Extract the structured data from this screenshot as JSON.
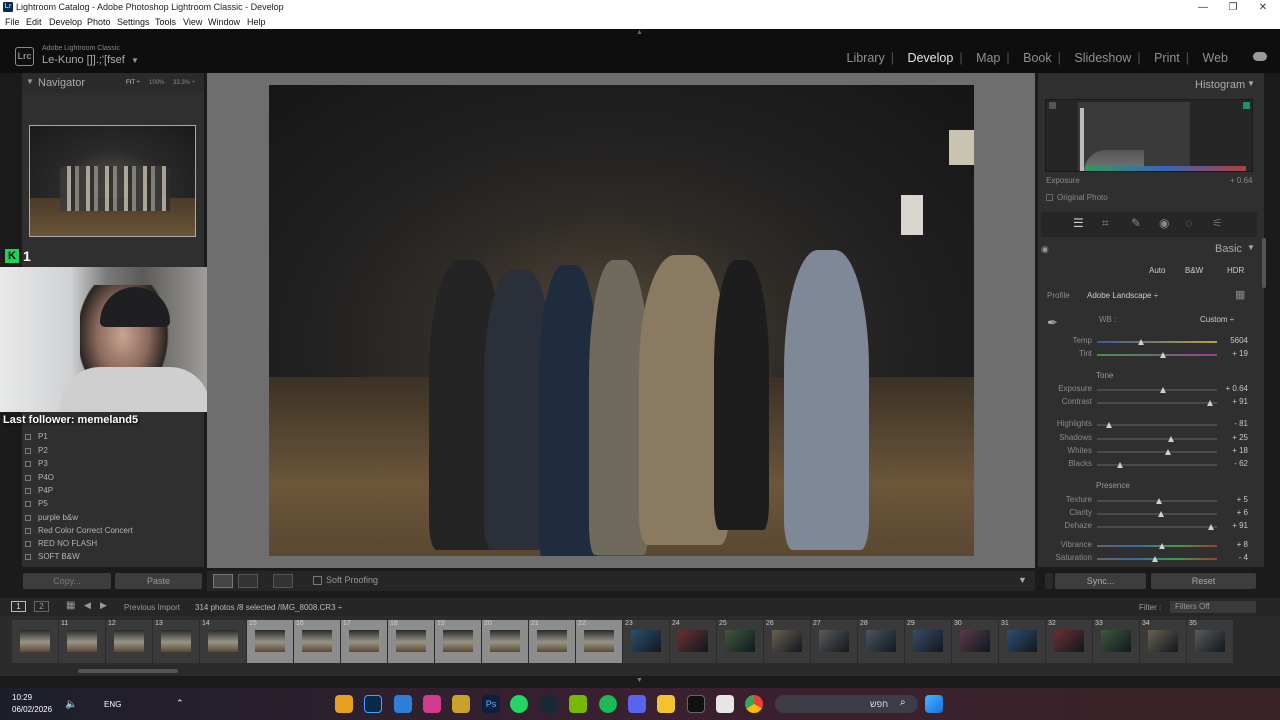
{
  "window": {
    "title": "Lightroom Catalog - Adobe Photoshop Lightroom Classic - Develop",
    "menu": [
      "File",
      "Edit",
      "Develop",
      "Photo",
      "Settings",
      "Tools",
      "View",
      "Window",
      "Help"
    ]
  },
  "header": {
    "brand": "Adobe Lightroom Classic",
    "catalog": "Le-Kuno []].;'[fsef",
    "logo": "Lrc",
    "modules": [
      "Library",
      "Develop",
      "Map",
      "Book",
      "Slideshow",
      "Print",
      "Web"
    ],
    "active_module": "Develop"
  },
  "left": {
    "navigator_title": "Navigator",
    "zoom_options": [
      "FIT ÷",
      "100%",
      "33.3% ÷"
    ],
    "presets": [
      "P1",
      "P2",
      "P3",
      "P4O",
      "P4P",
      "P5",
      "purple b&w",
      "Red Color Correct Concert",
      "RED NO FLASH",
      "SOFT B&W"
    ],
    "copy_label": "Copy...",
    "paste_label": "Paste"
  },
  "overlay": {
    "badge": "K",
    "count": "1",
    "last_follower": "Last follower: memeland5"
  },
  "toolbar": {
    "soft_proofing": "Soft Proofing"
  },
  "right": {
    "histogram_title": "Histogram",
    "exposure_label": "Exposure",
    "exposure_value": "+ 0.64",
    "original_photo": "Original Photo",
    "basic_title": "Basic",
    "treatment": [
      "Auto",
      "B&W",
      "HDR"
    ],
    "profile_label": "Profile",
    "profile_value": "Adobe Landscape ÷",
    "wb_label": "WB :",
    "wb_value": "Custom ÷",
    "tone_label": "Tone",
    "presence_label": "Presence",
    "sliders": [
      {
        "label": "Temp",
        "value": "5604",
        "pos": 0.37
      },
      {
        "label": "Tint",
        "value": "+ 19",
        "pos": 0.55
      },
      {
        "label": "Exposure",
        "value": "+ 0.64",
        "pos": 0.55
      },
      {
        "label": "Contrast",
        "value": "+ 91",
        "pos": 0.94
      },
      {
        "label": "Highlights",
        "value": "- 81",
        "pos": 0.1
      },
      {
        "label": "Shadows",
        "value": "+ 25",
        "pos": 0.62
      },
      {
        "label": "Whites",
        "value": "+ 18",
        "pos": 0.59
      },
      {
        "label": "Blacks",
        "value": "- 62",
        "pos": 0.19
      },
      {
        "label": "Texture",
        "value": "+ 5",
        "pos": 0.52
      },
      {
        "label": "Clarity",
        "value": "+ 6",
        "pos": 0.53
      },
      {
        "label": "Dehaze",
        "value": "+ 91",
        "pos": 0.95
      },
      {
        "label": "Vibrance",
        "value": "+ 8",
        "pos": 0.54
      },
      {
        "label": "Saturation",
        "value": "- 4",
        "pos": 0.48
      }
    ],
    "sync_label": "Sync...",
    "reset_label": "Reset"
  },
  "filmstrip": {
    "views": [
      "1",
      "2"
    ],
    "source": "Previous Import",
    "info": "314 photos /8 selected /IMG_8008.CR3 ÷",
    "filter_label": "Filter :",
    "filter_value": "Filters Off",
    "cells": [
      "",
      "11",
      "12",
      "13",
      "14",
      "15",
      "16",
      "17",
      "18",
      "19",
      "20",
      "21",
      "22",
      "23",
      "24",
      "25",
      "26",
      "27",
      "28",
      "29",
      "30",
      "31",
      "32",
      "33",
      "34",
      "35",
      "36"
    ],
    "selected": [
      "15",
      "16",
      "17",
      "18",
      "19",
      "20",
      "21",
      "22"
    ]
  },
  "taskbar": {
    "time": "10:29",
    "date": "06/02/2026",
    "lang": "ENG",
    "search_text": "חפש"
  }
}
